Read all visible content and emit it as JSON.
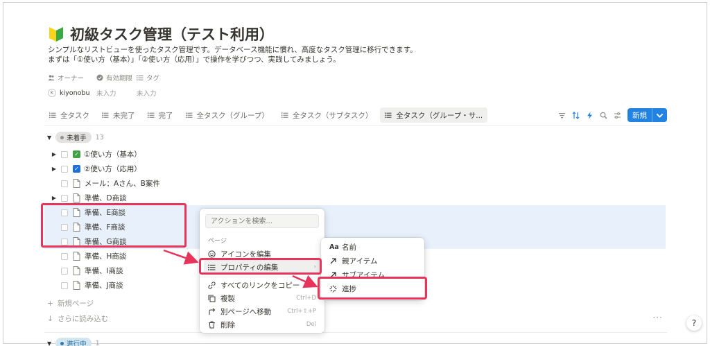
{
  "page": {
    "title": "初級タスク管理（テスト利用）",
    "description_line1": "シンプルなリストビューを使ったタスク管理です。データベース機能に慣れ、高度なタスク管理に移行できます。",
    "description_line2": "まずは「①使い方（基本）」「②使い方（応用）」で操作を学びつつ、実践してみましょう。"
  },
  "properties": {
    "owner_label": "オーナー",
    "due_label": "有効期限",
    "tag_label": "タグ",
    "owner_initial": "K",
    "owner_value": "kiyonobu",
    "due_value": "未入力",
    "tag_value": "未入力"
  },
  "tabs": [
    {
      "label": "全タスク"
    },
    {
      "label": "未完了"
    },
    {
      "label": "完了"
    },
    {
      "label": "全タスク（グループ）"
    },
    {
      "label": "全タスク（サブタスク）"
    },
    {
      "label": "全タスク（グループ・サ..."
    }
  ],
  "toolbar": {
    "new_label": "新規"
  },
  "groups": {
    "not_started": {
      "status": "未着手",
      "count": "13"
    },
    "in_progress": {
      "status": "進行中",
      "count": "1"
    }
  },
  "rows": [
    {
      "label": "①使い方（基本）"
    },
    {
      "label": "②使い方（応用）"
    },
    {
      "label": "メール：Aさん、B案件"
    },
    {
      "label": "準備、D商談"
    },
    {
      "label": "準備、E商談"
    },
    {
      "label": "準備、F商談"
    },
    {
      "label": "準備、G商談"
    },
    {
      "label": "準備、H商談"
    },
    {
      "label": "準備、I商談"
    },
    {
      "label": "準備、J商談"
    }
  ],
  "footer": {
    "new_page": "新規ページ",
    "load_more": "さらに読み込む"
  },
  "context_menu": {
    "search_placeholder": "アクションを検索...",
    "section": "ページ",
    "edit_icon": "アイコンを編集",
    "edit_property": "プロパティの編集",
    "copy_links": "すべてのリンクをコピー",
    "duplicate": "複製",
    "duplicate_shortcut": "Ctrl+D",
    "move": "別ページへ移動",
    "move_shortcut": "Ctrl+⇧+P",
    "delete": "削除",
    "delete_shortcut": "Del"
  },
  "submenu": {
    "name": "名前",
    "parent": "親アイテム",
    "sub": "サブアイテム",
    "progress": "進捗"
  },
  "colors": {
    "accent": "#2383e2",
    "highlight": "#e8335b",
    "selection": "#e7f0fb"
  }
}
